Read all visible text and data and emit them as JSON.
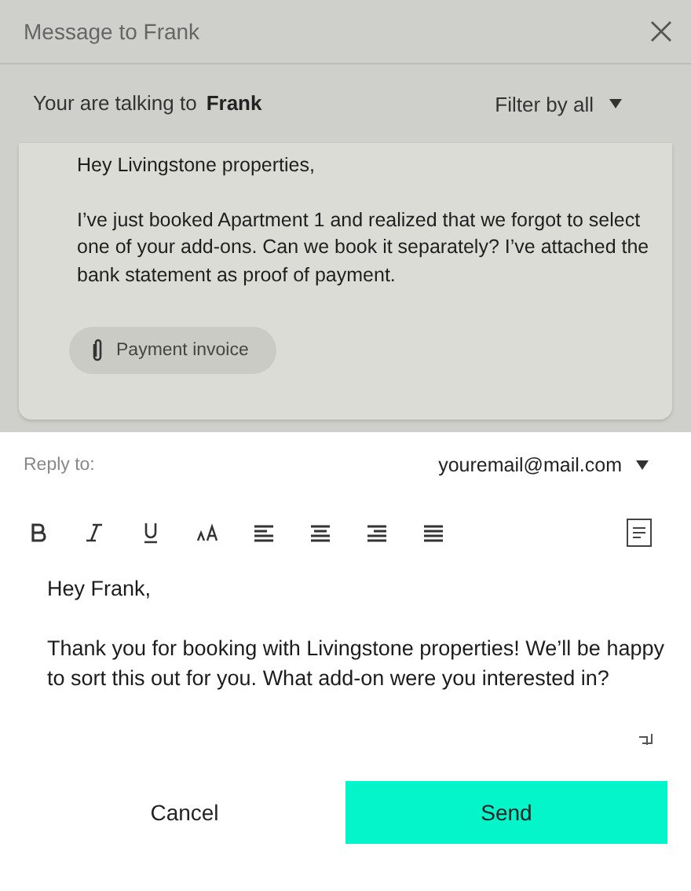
{
  "dialog": {
    "title": "Message to Frank"
  },
  "conversation": {
    "prefix": "Your are talking to",
    "name": "Frank",
    "filter": "Filter by all"
  },
  "message": {
    "greeting": "Hey Livingstone properties,",
    "body": "I’ve just booked Apartment 1 and realized that we forgot to select one of your add-ons. Can we book it separately? I’ve attached the bank statement as proof of payment.",
    "attachment": "Payment invoice"
  },
  "reply": {
    "label": "Reply to:",
    "address": "youremail@mail.com",
    "greeting": "Hey Frank,",
    "body": "Thank you for booking with Livingstone properties! We’ll be happy to sort this out for you. What add-on were you interested in?"
  },
  "buttons": [
    {
      "label": "Cancel",
      "kind": "secondary"
    },
    {
      "label": "Send",
      "kind": "primary"
    }
  ]
}
